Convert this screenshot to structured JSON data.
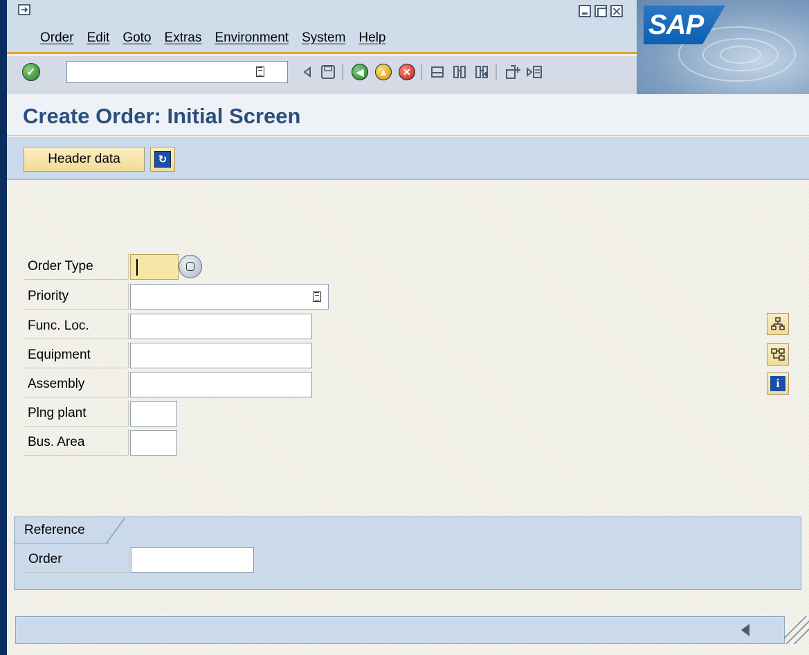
{
  "menu": {
    "items": [
      "Order",
      "Edit",
      "Goto",
      "Extras",
      "Environment",
      "System",
      "Help"
    ]
  },
  "logo": {
    "text": "SAP"
  },
  "toolbar": {
    "command_value": "",
    "icons": [
      "enter-icon",
      "back-arrow-icon",
      "save-icon",
      "back-icon",
      "exit-icon",
      "cancel-icon",
      "print-icon",
      "find-icon",
      "find-next-icon",
      "create-session-icon",
      "shortcut-icon"
    ]
  },
  "page": {
    "title": "Create Order: Initial Screen"
  },
  "app_toolbar": {
    "header_data_label": "Header data"
  },
  "form": {
    "fields": [
      {
        "label": "Order Type",
        "value": ""
      },
      {
        "label": "Priority",
        "value": ""
      },
      {
        "label": "Func. Loc.",
        "value": ""
      },
      {
        "label": "Equipment",
        "value": ""
      },
      {
        "label": "Assembly",
        "value": ""
      },
      {
        "label": "Plng plant",
        "value": ""
      },
      {
        "label": "Bus. Area",
        "value": ""
      }
    ]
  },
  "reference": {
    "tab_label": "Reference",
    "order_label": "Order",
    "order_value": ""
  },
  "colors": {
    "accent": "#e7a33c",
    "title": "#2a4f7c",
    "required_field": "#f8e6a6"
  }
}
